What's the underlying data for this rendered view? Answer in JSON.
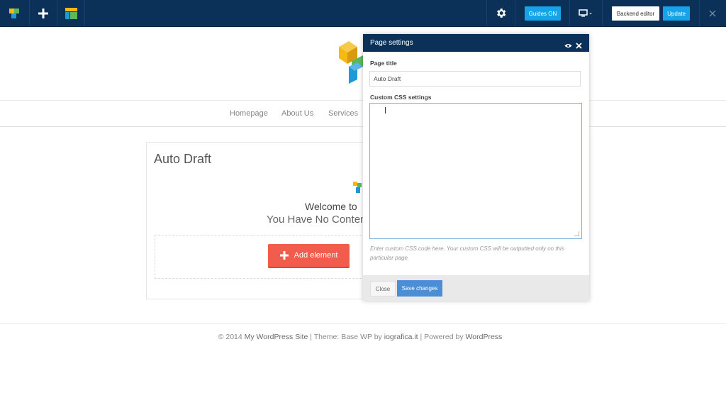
{
  "toolbar": {
    "logo_icon": "cubes-logo-icon",
    "add_icon": "plus-icon",
    "templates_icon": "layout-icon",
    "settings_icon": "gear-icon",
    "guides_label": "Guides ON",
    "device_icon": "monitor-icon",
    "backend_editor_label": "Backend editor",
    "update_label": "Update",
    "close_icon": "close-icon"
  },
  "site": {
    "nav": [
      "Homepage",
      "About Us",
      "Services"
    ],
    "post_title": "Auto Draft",
    "welcome_line1": "Welcome to",
    "welcome_line2": "You Have No Conten",
    "add_element_label": "Add element",
    "footer": {
      "copyright": "© 2014",
      "site_name": "My WordPress Site",
      "separator1": "|",
      "theme_prefix": "Theme: Base WP by",
      "theme_author": "iografica.it",
      "separator2": "|",
      "powered_prefix": "Powered by",
      "powered_by": "WordPress"
    }
  },
  "modal": {
    "title": "Page settings",
    "page_title_label": "Page title",
    "page_title_value": "Auto Draft",
    "css_label": "Custom CSS settings",
    "css_value": "",
    "help_text": "Enter custom CSS code here. Your custom CSS will be outputted only on this particular page.",
    "close_label": "Close",
    "save_label": "Save changes"
  },
  "colors": {
    "toolbar_bg": "#0c3158",
    "accent_blue": "#16a3e8",
    "save_blue": "#4a8fd6",
    "add_red": "#f25c4d"
  }
}
